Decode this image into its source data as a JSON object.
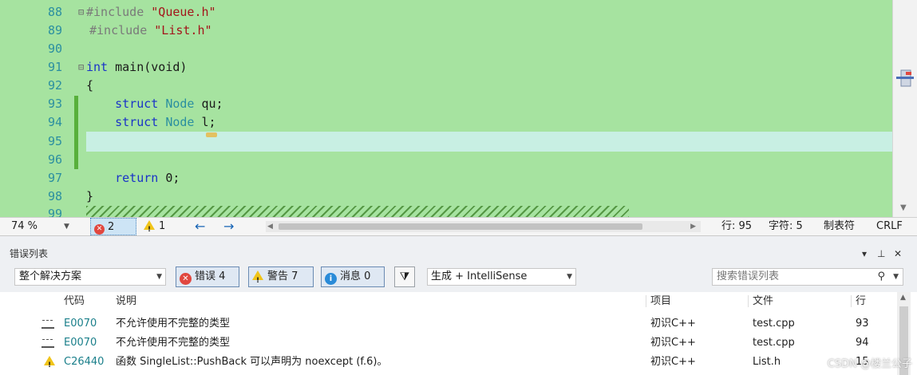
{
  "editor": {
    "line_numbers": [
      "88",
      "89",
      "90",
      "91",
      "92",
      "93",
      "94",
      "95",
      "96",
      "97",
      "98",
      "99"
    ],
    "lines": {
      "l88": {
        "pp": "#include",
        "sp": " ",
        "str": "\"Queue.h\""
      },
      "l89": {
        "pp": "#include",
        "sp": " ",
        "str": "\"List.h\""
      },
      "l91": {
        "kw": "int",
        "rest": " main(void)"
      },
      "l92": {
        "text": "{"
      },
      "l93": {
        "indent": "    ",
        "kw": "struct",
        "ty": " Node",
        "id": " qu;"
      },
      "l94": {
        "indent": "    ",
        "kw": "struct",
        "ty": " Node",
        "id": " l;"
      },
      "l97": {
        "indent": "    ",
        "kw": "return",
        "id": " 0;"
      },
      "l98": {
        "text": "}"
      }
    },
    "current_line_highlight": "#c8efe3",
    "background": "#a6e3a0"
  },
  "statusbar": {
    "zoom": "74 %",
    "errors": "2",
    "warnings": "1",
    "line": "行: 95",
    "char": "字符: 5",
    "indent": "制表符",
    "eol": "CRLF"
  },
  "error_list": {
    "title": "错误列表",
    "scope": "整个解决方案",
    "errors_button": "错误 4",
    "warnings_button": "警告 7",
    "messages_button": "消息 0",
    "build_filter": "生成 + IntelliSense",
    "search_placeholder": "搜索错误列表",
    "columns": {
      "code": "代码",
      "desc": "说明",
      "project": "项目",
      "file": "文件",
      "line": "行"
    },
    "rows": [
      {
        "code": "E0070",
        "desc": "不允许使用不完整的类型",
        "project": "初识C++",
        "file": "test.cpp",
        "line": "93"
      },
      {
        "code": "E0070",
        "desc": "不允许使用不完整的类型",
        "project": "初识C++",
        "file": "test.cpp",
        "line": "94"
      },
      {
        "code": "C26440",
        "desc": "函数 SingleList::PushBack 可以声明为 noexcept (f.6)。",
        "project": "初识C++",
        "file": "List.h",
        "line": "15"
      }
    ],
    "watermark": "CSDN @楼兰公子"
  },
  "colors": {
    "error": "#e1473f",
    "warning": "#f0c419",
    "info": "#2a8bd8",
    "accent": "#1764b5"
  }
}
